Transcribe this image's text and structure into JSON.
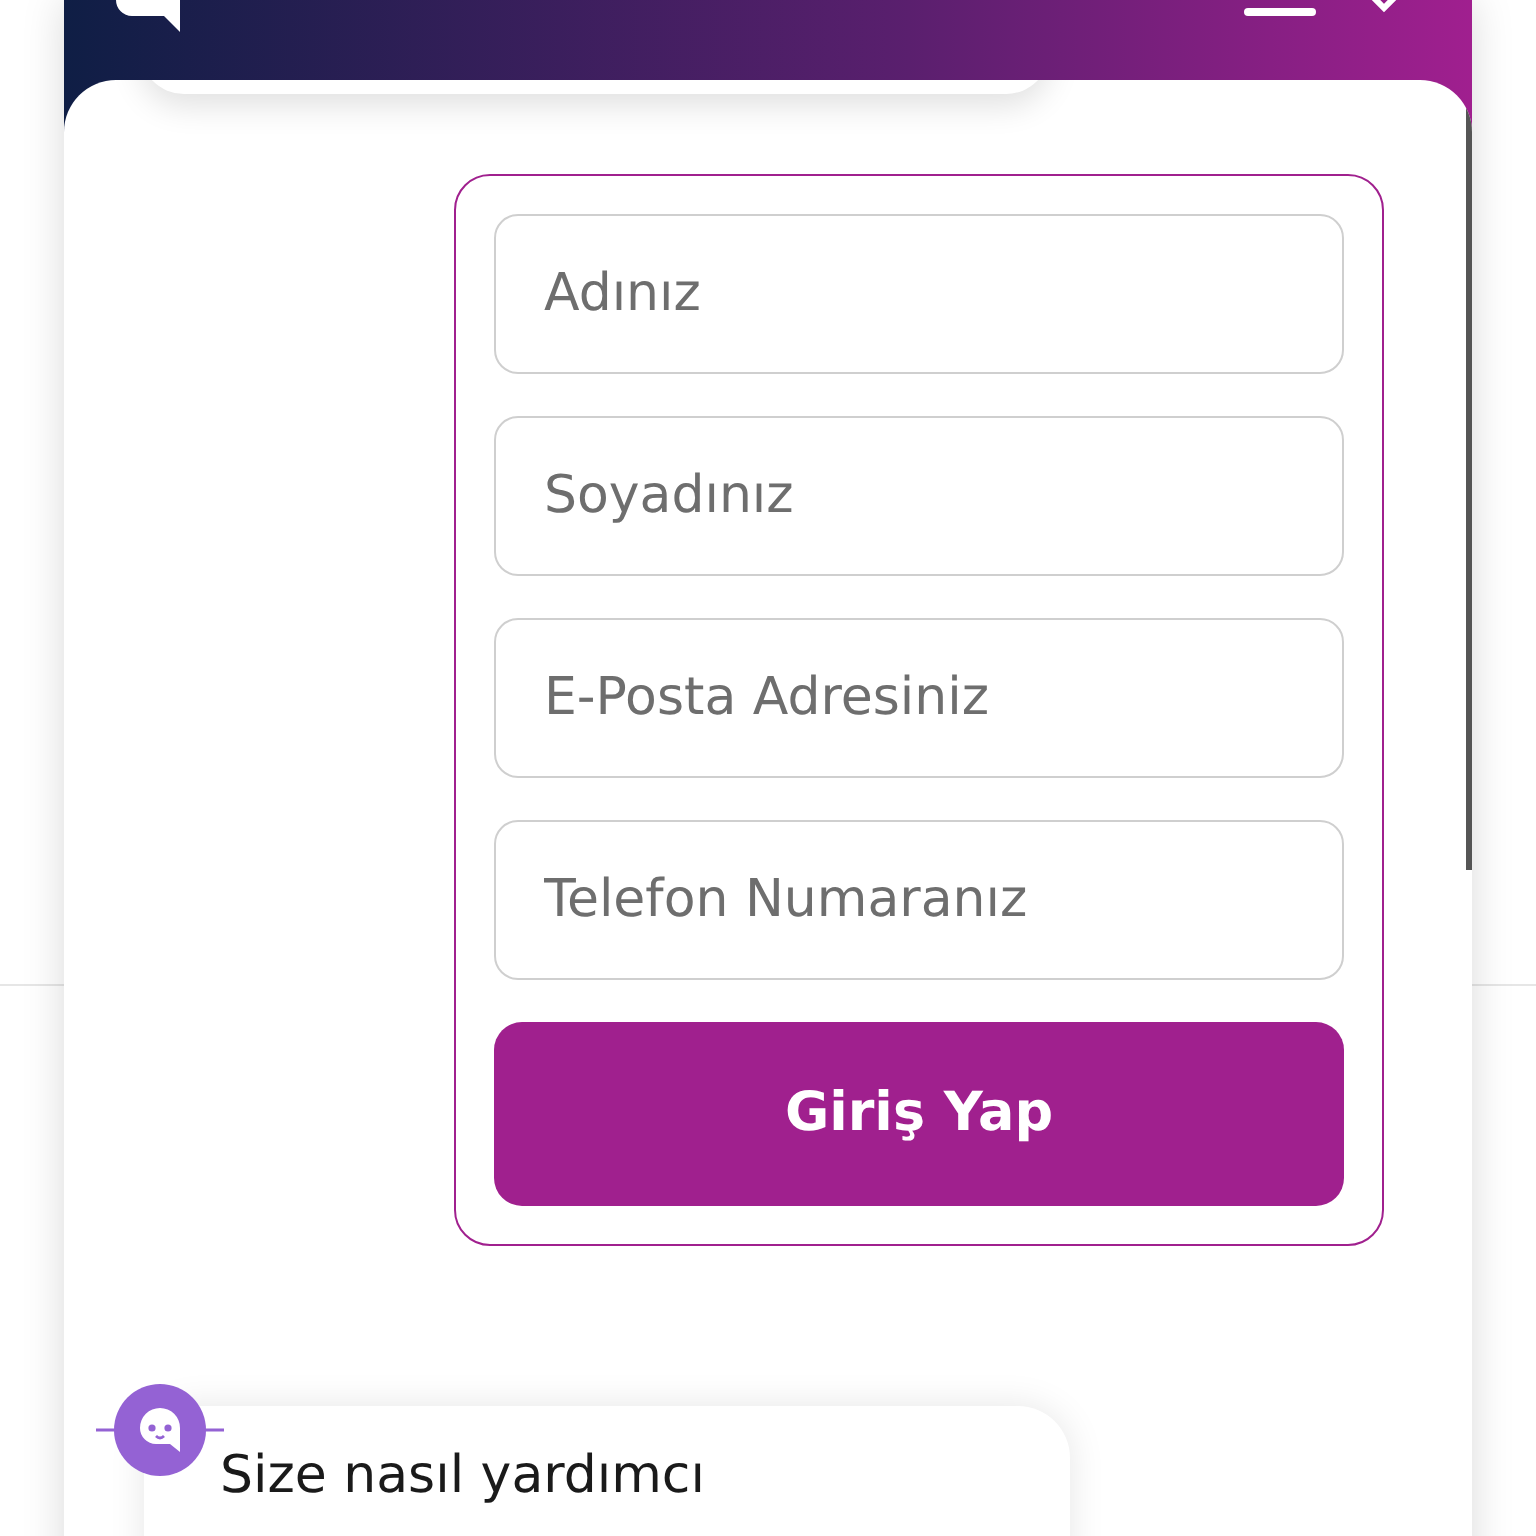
{
  "form": {
    "fields": [
      {
        "placeholder": "Adınız"
      },
      {
        "placeholder": "Soyadınız"
      },
      {
        "placeholder": "E-Posta Adresiniz"
      },
      {
        "placeholder": "Telefon Numaranız"
      }
    ],
    "submit": "Giriş Yap"
  },
  "bot_message": {
    "text": "Size nasıl yardımcı"
  }
}
